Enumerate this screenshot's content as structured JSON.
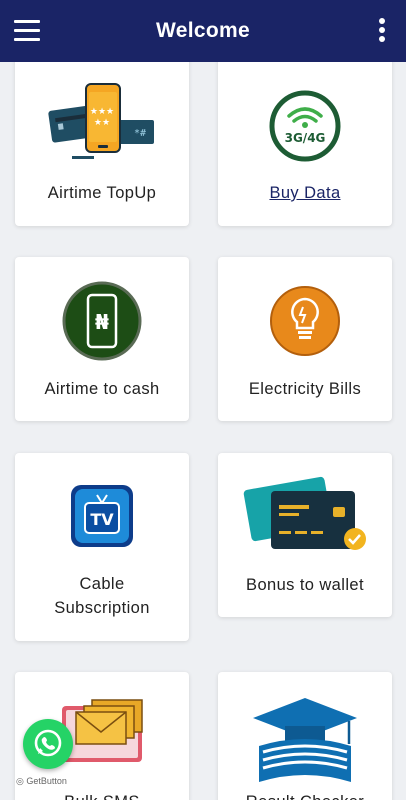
{
  "header": {
    "title": "Welcome",
    "menu_icon": "hamburger-menu-icon",
    "more_icon": "kebab-menu-icon"
  },
  "services": [
    {
      "label": "Airtime TopUp",
      "icon": "phone-cards-icon"
    },
    {
      "label": "Buy Data",
      "icon": "3g-4g-wifi-icon"
    },
    {
      "label": "Airtime to cash",
      "icon": "naira-phone-icon"
    },
    {
      "label": "Electricity Bills",
      "icon": "lightbulb-icon"
    },
    {
      "label": "Cable Subscription",
      "icon": "tv-icon"
    },
    {
      "label": "Bonus to wallet",
      "icon": "credit-cards-icon"
    },
    {
      "label": "Bulk SMS",
      "icon": "envelopes-icon"
    },
    {
      "label": "Result Checker",
      "icon": "graduation-cap-book-icon"
    }
  ],
  "widget": {
    "label": "GetButton",
    "icon": "whatsapp-icon"
  },
  "colors": {
    "header": "#1a2466",
    "background": "#eef0f3",
    "whatsapp": "#25d366"
  }
}
